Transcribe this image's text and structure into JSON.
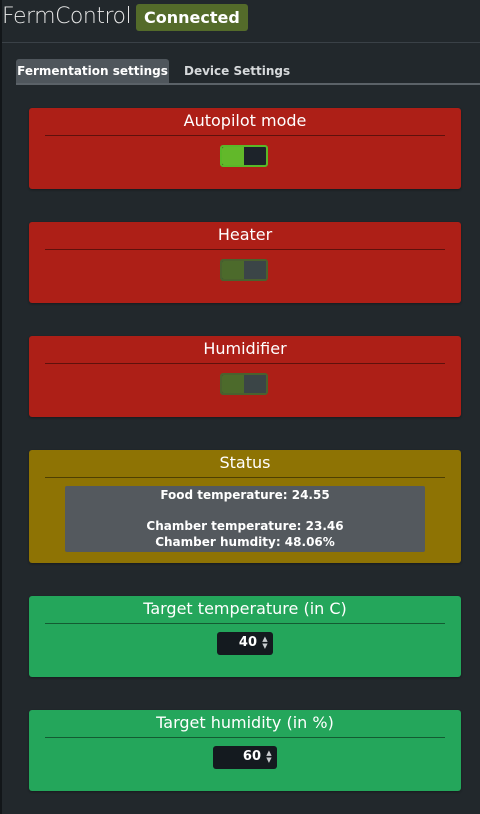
{
  "app": {
    "title": "FermControl",
    "connection_status": "Connected",
    "colors": {
      "background": "#22282c",
      "connected_badge": "#546b2a",
      "panel_red": "#ad1f17",
      "panel_yellow": "#8e7304",
      "panel_green": "#24a65b",
      "toggle_on": "#62b82a"
    }
  },
  "tabs": [
    {
      "label": "Fermentation settings",
      "active": true
    },
    {
      "label": "Device Settings",
      "active": false
    }
  ],
  "autopilot": {
    "title": "Autopilot mode",
    "enabled": true
  },
  "heater": {
    "title": "Heater",
    "enabled": true,
    "disabled_control": true
  },
  "humidifier": {
    "title": "Humidifier",
    "enabled": true,
    "disabled_control": true
  },
  "status": {
    "title": "Status",
    "food_temperature": "Food temperature: 24.55",
    "chamber_temperature": "Chamber temperature: 23.46",
    "chamber_humidity": "Chamber humdity: 48.06%"
  },
  "target_temperature": {
    "title": "Target temperature (in C)",
    "value": "40"
  },
  "target_humidity": {
    "title": "Target humidity (in %)",
    "value": "60"
  }
}
